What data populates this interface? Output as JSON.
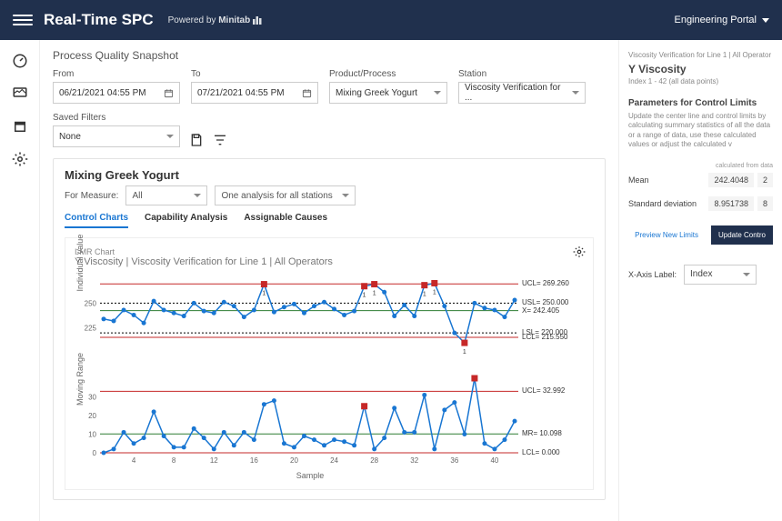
{
  "topbar": {
    "title": "Real-Time SPC",
    "powered": "Powered by",
    "brand": "Minitab",
    "portal": "Engineering Portal"
  },
  "page": {
    "title": "Process Quality Snapshot"
  },
  "filters": {
    "from_label": "From",
    "from_value": "06/21/2021 04:55 PM",
    "to_label": "To",
    "to_value": "07/21/2021 04:55 PM",
    "product_label": "Product/Process",
    "product_value": "Mixing Greek Yogurt",
    "station_label": "Station",
    "station_value": "Viscosity Verification for ...",
    "saved_label": "Saved Filters",
    "saved_value": "None"
  },
  "card": {
    "title": "Mixing Greek Yogurt",
    "for_measure": "For Measure:",
    "measure_value": "All",
    "analysis_value": "One analysis for all stations"
  },
  "tabs": {
    "control": "Control Charts",
    "capability": "Capability Analysis",
    "causes": "Assignable Causes"
  },
  "chart": {
    "type": "I-MR Chart",
    "title": "Y Viscosity | Viscosity Verification for Line 1 | All Operators",
    "y1_label": "Individual Value",
    "y2_label": "Moving Range",
    "x_label": "Sample",
    "refs1": {
      "ucl": "UCL= 269.260",
      "usl": "USL= 250.000",
      "xbar": "X= 242.405",
      "lsl": "LSL= 220.000",
      "lcl": "LCL= 215.550"
    },
    "refs2": {
      "ucl": "UCL= 32.992",
      "mr": "MR= 10.098",
      "lcl": "LCL= 0.000"
    },
    "xticks": [
      "4",
      "8",
      "12",
      "16",
      "20",
      "24",
      "28",
      "32",
      "36",
      "40"
    ]
  },
  "rpanel": {
    "crumb": "Viscosity Verification for Line 1 | All Operator",
    "title": "Y Viscosity",
    "index": "Index 1 - 42 (all data points)",
    "params_h": "Parameters for Control Limits",
    "params_desc": "Update the center line and control limits by calculating summary statistics of all the data or a range of data, use these calculated values or adjust the calculated v",
    "col_head": "calculated from data",
    "mean_label": "Mean",
    "mean_val": "242.4048",
    "sd_label": "Standard deviation",
    "sd_val": "8.951738",
    "preview": "Preview New Limits",
    "update": "Update Contro",
    "xaxis_label": "X-Axis Label:",
    "xaxis_value": "Index"
  },
  "chart_data": [
    {
      "type": "line",
      "title": "Individual Value",
      "x": [
        1,
        2,
        3,
        4,
        5,
        6,
        7,
        8,
        9,
        10,
        11,
        12,
        13,
        14,
        15,
        16,
        17,
        18,
        19,
        20,
        21,
        22,
        23,
        24,
        25,
        26,
        27,
        28,
        29,
        30,
        31,
        32,
        33,
        34,
        35,
        36,
        37,
        38,
        39,
        40,
        41,
        42
      ],
      "y": [
        234,
        232,
        243,
        238,
        230,
        252,
        243,
        240,
        237,
        250,
        242,
        240,
        251,
        247,
        236,
        243,
        269,
        241,
        246,
        249,
        240,
        247,
        251,
        244,
        238,
        242,
        267,
        269,
        261,
        237,
        248,
        237,
        268,
        270,
        247,
        220,
        210,
        250,
        245,
        243,
        236,
        253
      ],
      "ucl": 269.26,
      "lcl": 215.55,
      "xbar": 242.405,
      "usl": 250,
      "lsl": 220,
      "ylim": [
        200,
        275
      ],
      "ooc_points": [
        17,
        27,
        28,
        33,
        34,
        37
      ]
    },
    {
      "type": "line",
      "title": "Moving Range",
      "x": [
        1,
        2,
        3,
        4,
        5,
        6,
        7,
        8,
        9,
        10,
        11,
        12,
        13,
        14,
        15,
        16,
        17,
        18,
        19,
        20,
        21,
        22,
        23,
        24,
        25,
        26,
        27,
        28,
        29,
        30,
        31,
        32,
        33,
        34,
        35,
        36,
        37,
        38,
        39,
        40,
        41,
        42
      ],
      "y": [
        0,
        2,
        11,
        5,
        8,
        22,
        9,
        3,
        3,
        13,
        8,
        2,
        11,
        4,
        11,
        7,
        26,
        28,
        5,
        3,
        9,
        7,
        4,
        7,
        6,
        4,
        25,
        2,
        8,
        24,
        11,
        11,
        31,
        2,
        23,
        27,
        10,
        40,
        5,
        2,
        7,
        17
      ],
      "ucl": 32.992,
      "mr": 10.098,
      "lcl": 0,
      "ylim": [
        0,
        40
      ],
      "ooc_points": [
        27,
        38
      ]
    }
  ]
}
